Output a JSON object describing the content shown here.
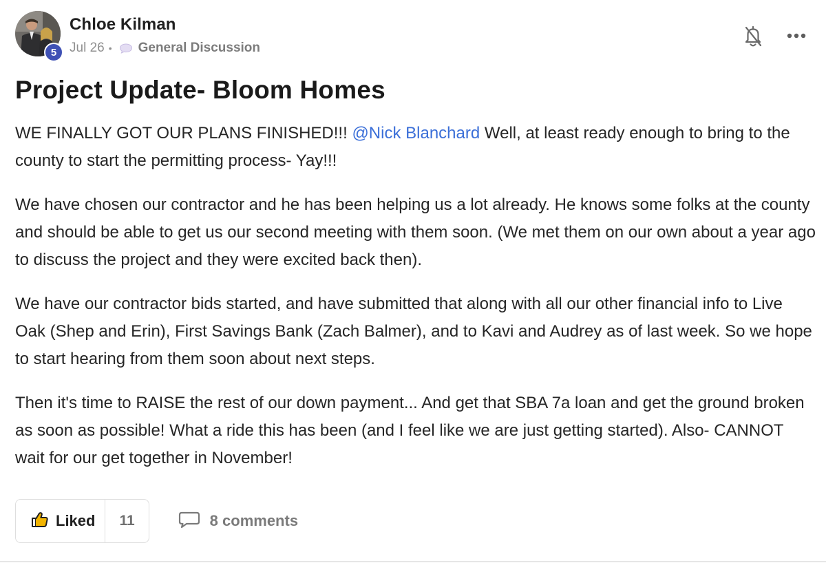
{
  "post": {
    "author": "Chloe Kilman",
    "level": "5",
    "date": "Jul 26",
    "separator": "•",
    "category": "General Discussion",
    "title": "Project Update- Bloom Homes",
    "paragraphs": [
      {
        "before": "WE FINALLY GOT OUR PLANS FINISHED!!! ",
        "mention": "@Nick Blanchard",
        "after": " Well, at least ready enough to bring to the county to start the permitting process- Yay!!!"
      },
      {
        "text": "We have chosen our contractor and he has been helping us a lot already. He knows some folks at the county and should be able to get us our second meeting with them soon. (We met them on our own about a year ago to discuss the project and they were excited back then)."
      },
      {
        "text": "We have our contractor bids started, and have submitted that along with all our other financial info to Live Oak (Shep and Erin), First Savings Bank (Zach Balmer), and to Kavi and Audrey as of last week. So we hope to start hearing from them soon about next steps."
      },
      {
        "text": "Then it's time to RAISE the rest of our down payment... And get that SBA 7a loan and get the ground broken as soon as possible! What a ride this has been (and I feel like we are just getting started). Also- CANNOT wait for our get together in November!"
      }
    ],
    "like_label": "Liked",
    "like_count": "11",
    "comments_label": "8 comments"
  },
  "icons": {
    "avatar": "author-avatar-photo",
    "category": "chat-bubble-icon",
    "notify": "bell-off-icon",
    "more": "more-horizontal-icon",
    "like": "thumbs-up-icon",
    "comments": "comment-icon"
  },
  "colors": {
    "level_badge": "#3f51b5",
    "mention": "#3b6fd8",
    "meta_text": "#909090"
  }
}
